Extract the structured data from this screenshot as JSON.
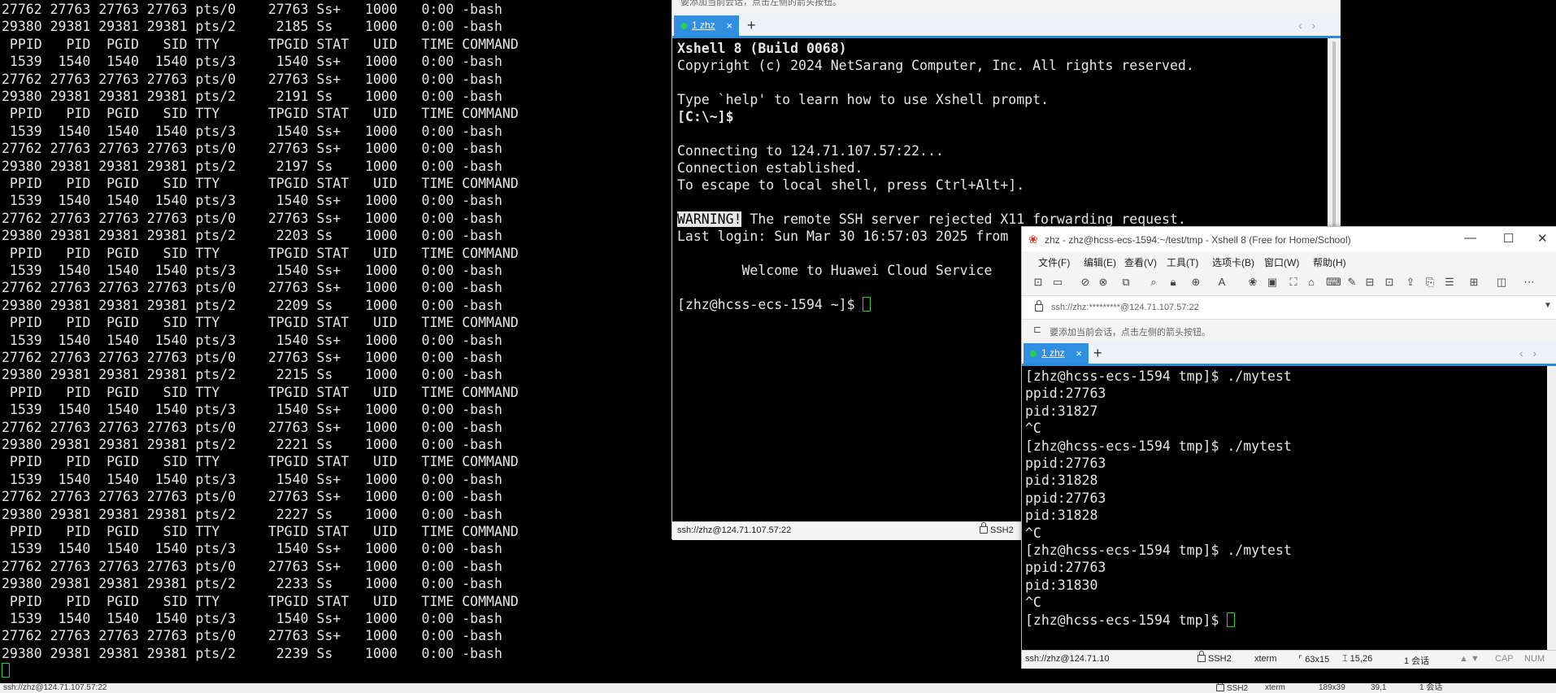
{
  "background_terminal": {
    "lines": [
      "27762 27763 27763 27763 pts/0    27763 Ss+   1000   0:00 -bash",
      "29380 29381 29381 29381 pts/2     2185 Ss    1000   0:00 -bash",
      " PPID   PID  PGID   SID TTY      TPGID STAT   UID   TIME COMMAND",
      " 1539  1540  1540  1540 pts/3     1540 Ss+   1000   0:00 -bash",
      "27762 27763 27763 27763 pts/0    27763 Ss+   1000   0:00 -bash",
      "29380 29381 29381 29381 pts/2     2191 Ss    1000   0:00 -bash",
      " PPID   PID  PGID   SID TTY      TPGID STAT   UID   TIME COMMAND",
      " 1539  1540  1540  1540 pts/3     1540 Ss+   1000   0:00 -bash",
      "27762 27763 27763 27763 pts/0    27763 Ss+   1000   0:00 -bash",
      "29380 29381 29381 29381 pts/2     2197 Ss    1000   0:00 -bash",
      " PPID   PID  PGID   SID TTY      TPGID STAT   UID   TIME COMMAND",
      " 1539  1540  1540  1540 pts/3     1540 Ss+   1000   0:00 -bash",
      "27762 27763 27763 27763 pts/0    27763 Ss+   1000   0:00 -bash",
      "29380 29381 29381 29381 pts/2     2203 Ss    1000   0:00 -bash",
      " PPID   PID  PGID   SID TTY      TPGID STAT   UID   TIME COMMAND",
      " 1539  1540  1540  1540 pts/3     1540 Ss+   1000   0:00 -bash",
      "27762 27763 27763 27763 pts/0    27763 Ss+   1000   0:00 -bash",
      "29380 29381 29381 29381 pts/2     2209 Ss    1000   0:00 -bash",
      " PPID   PID  PGID   SID TTY      TPGID STAT   UID   TIME COMMAND",
      " 1539  1540  1540  1540 pts/3     1540 Ss+   1000   0:00 -bash",
      "27762 27763 27763 27763 pts/0    27763 Ss+   1000   0:00 -bash",
      "29380 29381 29381 29381 pts/2     2215 Ss    1000   0:00 -bash",
      " PPID   PID  PGID   SID TTY      TPGID STAT   UID   TIME COMMAND",
      " 1539  1540  1540  1540 pts/3     1540 Ss+   1000   0:00 -bash",
      "27762 27763 27763 27763 pts/0    27763 Ss+   1000   0:00 -bash",
      "29380 29381 29381 29381 pts/2     2221 Ss    1000   0:00 -bash",
      " PPID   PID  PGID   SID TTY      TPGID STAT   UID   TIME COMMAND",
      " 1539  1540  1540  1540 pts/3     1540 Ss+   1000   0:00 -bash",
      "27762 27763 27763 27763 pts/0    27763 Ss+   1000   0:00 -bash",
      "29380 29381 29381 29381 pts/2     2227 Ss    1000   0:00 -bash",
      " PPID   PID  PGID   SID TTY      TPGID STAT   UID   TIME COMMAND",
      " 1539  1540  1540  1540 pts/3     1540 Ss+   1000   0:00 -bash",
      "27762 27763 27763 27763 pts/0    27763 Ss+   1000   0:00 -bash",
      "29380 29381 29381 29381 pts/2     2233 Ss    1000   0:00 -bash",
      " PPID   PID  PGID   SID TTY      TPGID STAT   UID   TIME COMMAND",
      " 1539  1540  1540  1540 pts/3     1540 Ss+   1000   0:00 -bash",
      "27762 27763 27763 27763 pts/0    27763 Ss+   1000   0:00 -bash",
      "29380 29381 29381 29381 pts/2     2239 Ss    1000   0:00 -bash"
    ],
    "status_address": "ssh://zhz@124.71.107.57:22",
    "status_protocol": "SSH2",
    "status_term": "xterm",
    "status_size": "189x39",
    "status_pos": "39,1",
    "status_sessions": "1 会话"
  },
  "middle_window": {
    "hint": "要添加当前会话，点击左侧的箭头按钮。",
    "tab_label": "1 zhz",
    "tab_close": "×",
    "tab_add": "+",
    "tab_nav": "‹ ›",
    "banner_title": "Xshell 8 (Build 0068)",
    "copyright": "Copyright (c) 2024 NetSarang Computer, Inc. All rights reserved.",
    "help_line": "Type `help' to learn how to use Xshell prompt.",
    "local_prompt": "[C:\\~]$",
    "connecting": "Connecting to 124.71.107.57:22...",
    "established": "Connection established.",
    "escape": "To escape to local shell, press Ctrl+Alt+].",
    "warning_tag": "WARNING!",
    "warning_text": " The remote SSH server rejected X11 forwarding request.",
    "last_login": "Last login: Sun Mar 30 16:57:03 2025 from",
    "welcome": "        Welcome to Huawei Cloud Service",
    "prompt": "[zhz@hcss-ecs-1594 ~]$ ",
    "status_address": "ssh://zhz@124.71.107.57:22",
    "status_protocol": "SSH2"
  },
  "right_window": {
    "title": "zhz - zhz@hcss-ecs-1594:~/test/tmp - Xshell 8 (Free for Home/School)",
    "menu": [
      "文件(F)",
      "编辑(E)",
      "查看(V)",
      "工具(T)",
      "选项卡(B)",
      "窗口(W)",
      "帮助(H)"
    ],
    "address": "ssh://zhz:*********@124.71.107.57:22",
    "hint": "要添加当前会话，点击左侧的箭头按钮。",
    "tab_label": "1 zhz",
    "tab_close": "×",
    "tab_add": "+",
    "tab_nav": "‹ ›",
    "terminal_lines": [
      "[zhz@hcss-ecs-1594 tmp]$ ./mytest",
      "ppid:27763",
      "pid:31827",
      "^C",
      "[zhz@hcss-ecs-1594 tmp]$ ./mytest",
      "ppid:27763",
      "pid:31828",
      "ppid:27763",
      "pid:31828",
      "^C",
      "[zhz@hcss-ecs-1594 tmp]$ ./mytest",
      "ppid:27763",
      "pid:31830",
      "^C"
    ],
    "prompt": "[zhz@hcss-ecs-1594 tmp]$ ",
    "status_address": "ssh://zhz@124.71.10",
    "status_protocol": "SSH2",
    "status_term": "xterm",
    "status_size": "63x15",
    "status_pos": "15,26",
    "status_sessions": "1 会话",
    "status_caps": "CAP",
    "status_num": "NUM"
  }
}
